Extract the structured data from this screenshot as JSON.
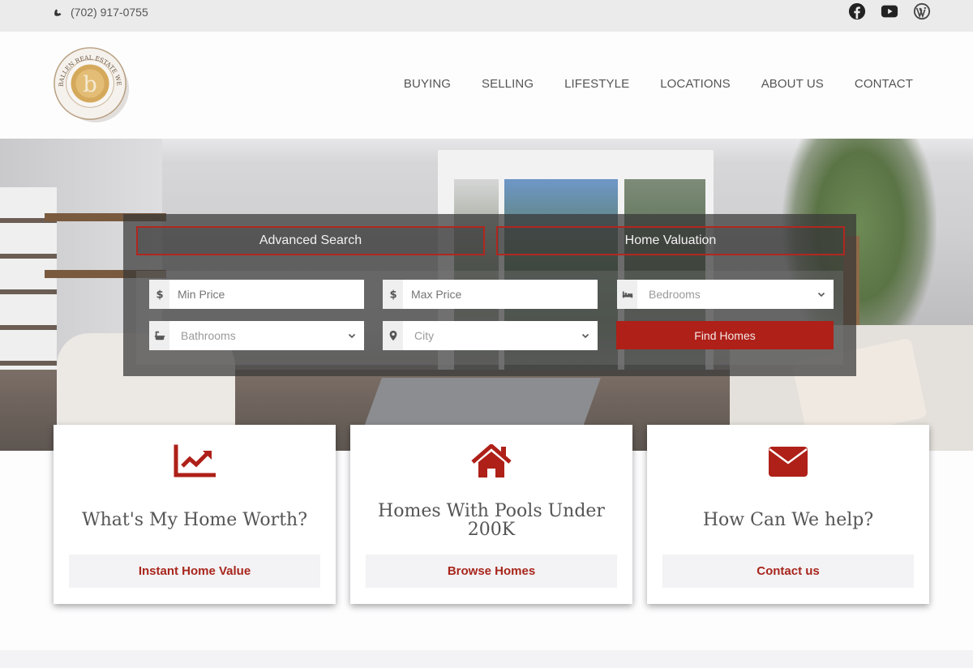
{
  "topbar": {
    "phone": "(702) 917-0755",
    "socials": [
      {
        "icon": "facebook-icon"
      },
      {
        "icon": "youtube-icon"
      },
      {
        "icon": "wordpress-icon"
      }
    ]
  },
  "header": {
    "logo_text": "BALLEN REAL ESTATE WEBSITES",
    "logo_letter": "b",
    "nav": [
      "BUYING",
      "SELLING",
      "LIFESTYLE",
      "LOCATIONS",
      "ABOUT US",
      "CONTACT"
    ]
  },
  "search": {
    "tabs": [
      "Advanced Search",
      "Home Valuation"
    ],
    "min_price_placeholder": "Min Price",
    "max_price_placeholder": "Max Price",
    "bedrooms": "Bedrooms",
    "bathrooms": "Bathrooms",
    "city": "City",
    "find_button": "Find Homes"
  },
  "cards": [
    {
      "icon": "chart-line-icon",
      "title": "What's My Home Worth?",
      "button": "Instant Home Value"
    },
    {
      "icon": "home-icon",
      "title": "Homes With Pools Under 200K",
      "button": "Browse Homes"
    },
    {
      "icon": "envelope-icon",
      "title": "How Can We help?",
      "button": "Contact us"
    }
  ],
  "colors": {
    "accent": "#ae2018",
    "topbar": "#ebebeb",
    "card_button_bg": "#f3f2f4"
  }
}
